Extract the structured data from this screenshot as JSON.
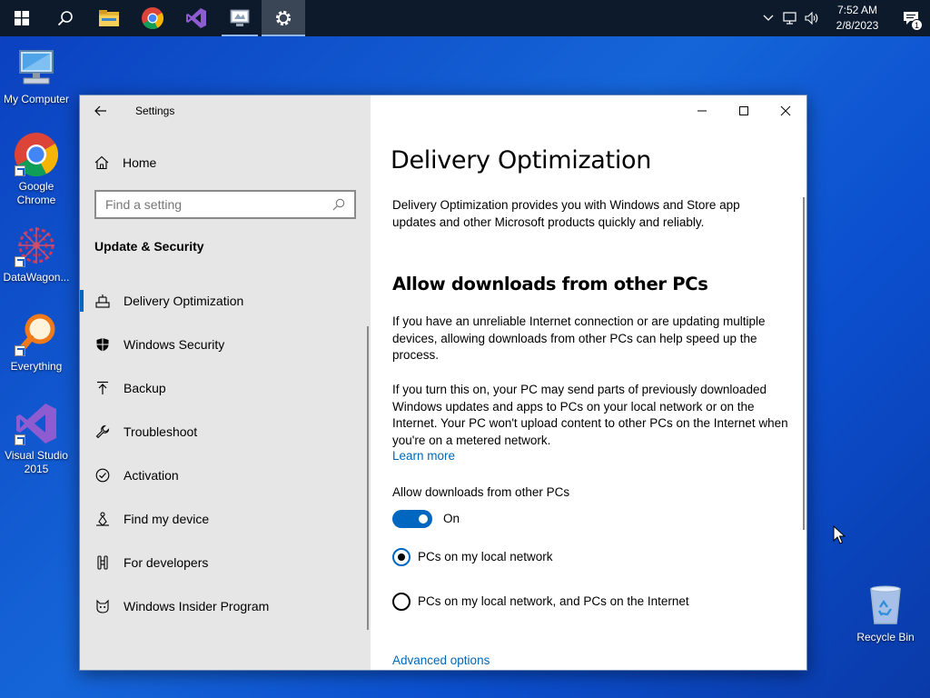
{
  "taskbar": {
    "start": "start-icon",
    "pinned": [
      "search-icon",
      "file-explorer-icon",
      "chrome-icon",
      "visual-studio-icon",
      "remote-desktop-icon",
      "settings-icon"
    ],
    "clock_time": "7:52 AM",
    "clock_date": "2/8/2023",
    "notification_count": "1"
  },
  "desktop": {
    "icons": [
      {
        "label": "My Computer",
        "icon": "computer-icon"
      },
      {
        "label": "Google Chrome",
        "icon": "chrome-icon"
      },
      {
        "label": "DataWagon...",
        "icon": "datawagon-icon"
      },
      {
        "label": "Everything",
        "icon": "everything-icon"
      },
      {
        "label": "Visual Studio 2015",
        "icon": "visual-studio-icon"
      },
      {
        "label": "Recycle Bin",
        "icon": "recycle-bin-icon"
      }
    ]
  },
  "window": {
    "title": "Settings",
    "home_label": "Home",
    "search_placeholder": "Find a setting",
    "section": "Update & Security",
    "nav": [
      {
        "label": "Delivery Optimization",
        "icon": "delivery-optimization-icon",
        "selected": true
      },
      {
        "label": "Windows Security",
        "icon": "shield-icon"
      },
      {
        "label": "Backup",
        "icon": "backup-icon"
      },
      {
        "label": "Troubleshoot",
        "icon": "wrench-icon"
      },
      {
        "label": "Activation",
        "icon": "activation-icon"
      },
      {
        "label": "Find my device",
        "icon": "find-device-icon"
      },
      {
        "label": "For developers",
        "icon": "developer-icon"
      },
      {
        "label": "Windows Insider Program",
        "icon": "insider-icon"
      }
    ]
  },
  "main": {
    "title": "Delivery Optimization",
    "intro": "Delivery Optimization provides you with Windows and Store app updates and other Microsoft products quickly and reliably.",
    "subheading": "Allow downloads from other PCs",
    "para1": "If you have an unreliable Internet connection or are updating multiple devices, allowing downloads from other PCs can help speed up the process.",
    "para2": "If you turn this on, your PC may send parts of previously downloaded Windows updates and apps to PCs on your local network or on the Internet. Your PC won't upload content to other PCs on the Internet when you're on a metered network.",
    "learn_more": "Learn more",
    "toggle_label": "Allow downloads from other PCs",
    "toggle_state": "On",
    "radio_local": "PCs on my local network",
    "radio_internet": "PCs on my local network, and PCs on the Internet",
    "advanced": "Advanced options"
  },
  "colors": {
    "accent": "#0067c0",
    "link": "#0067b8",
    "sidebar_bg": "#e6e6e6",
    "taskbar_bg": "#0d1a2b"
  }
}
